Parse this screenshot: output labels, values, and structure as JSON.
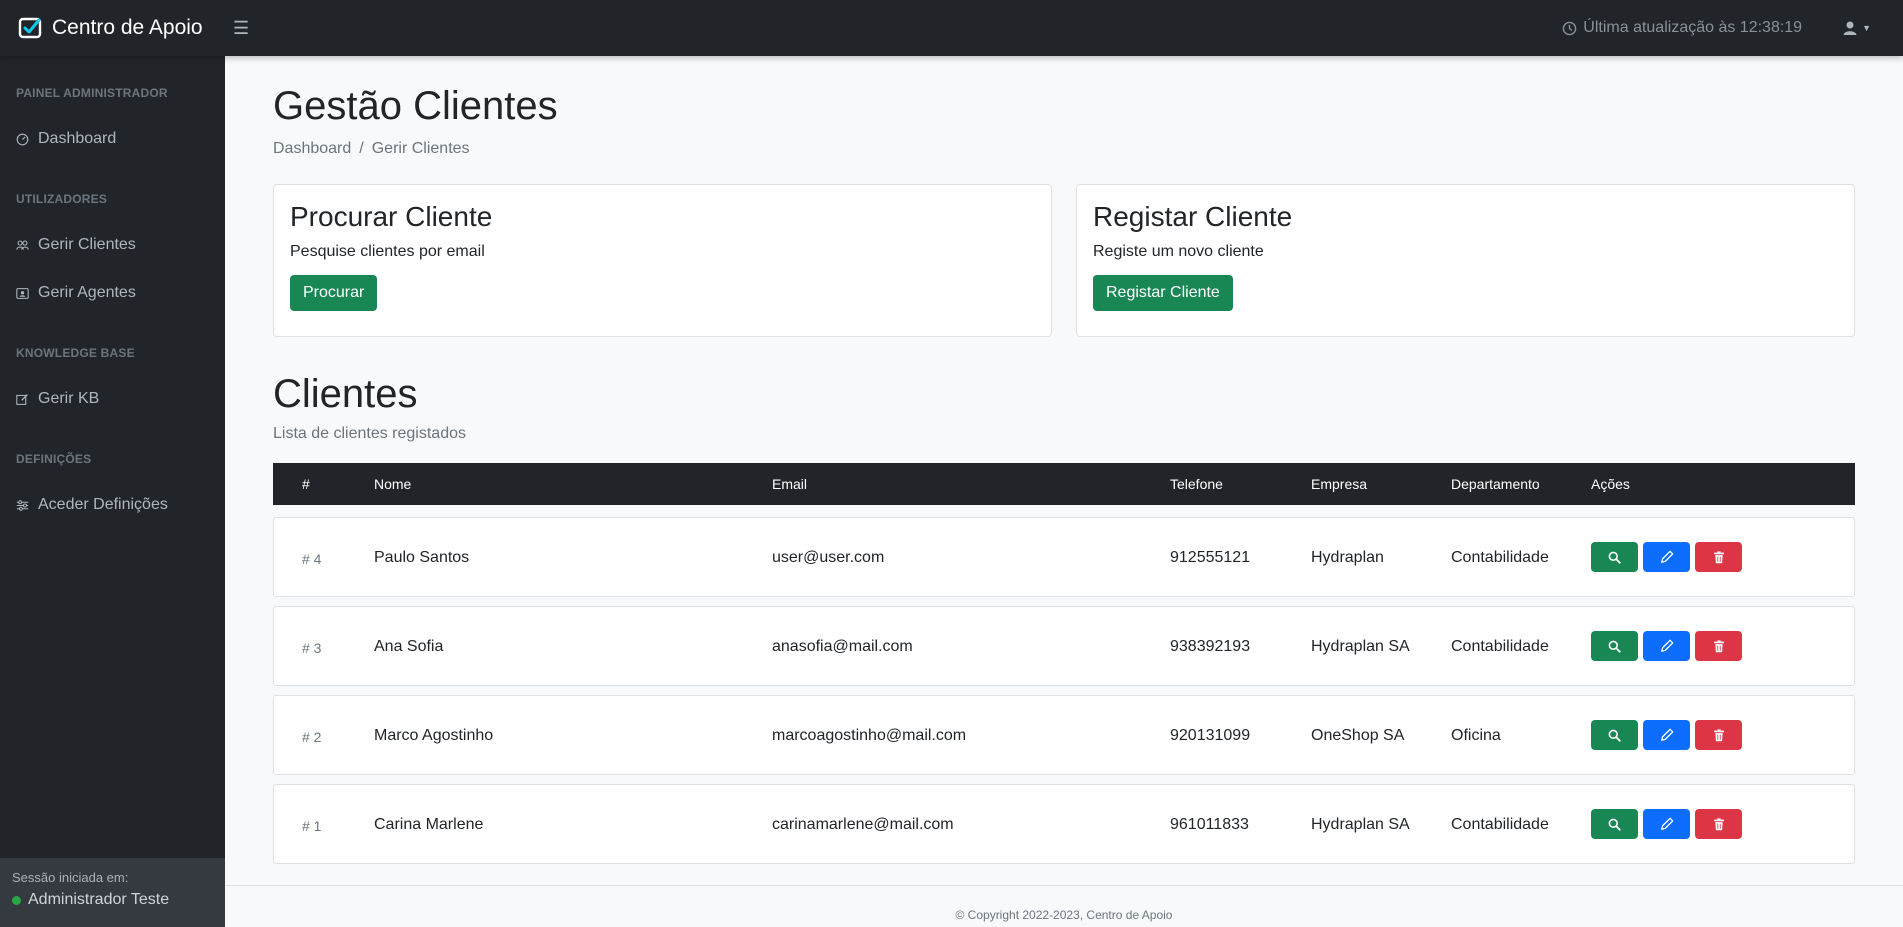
{
  "app": {
    "title": "Centro de Apoio"
  },
  "topbar": {
    "last_update": "Última atualização às 12:38:19"
  },
  "sidebar": {
    "sections": [
      {
        "heading": "PAINEL ADMINISTRADOR",
        "items": [
          {
            "label": "Dashboard",
            "icon": "gauge-icon"
          }
        ]
      },
      {
        "heading": "UTILIZADORES",
        "items": [
          {
            "label": "Gerir Clientes",
            "icon": "users-icon"
          },
          {
            "label": "Gerir Agentes",
            "icon": "id-card-icon"
          }
        ]
      },
      {
        "heading": "KNOWLEDGE BASE",
        "items": [
          {
            "label": "Gerir KB",
            "icon": "edit-icon"
          }
        ]
      },
      {
        "heading": "DEFINIÇÕES",
        "items": [
          {
            "label": "Aceder Definições",
            "icon": "sliders-icon"
          }
        ]
      }
    ],
    "session_label": "Sessão iniciada em:",
    "session_user": "Administrador Teste",
    "session_status_color": "#28a745"
  },
  "page": {
    "title": "Gestão Clientes",
    "breadcrumb": [
      "Dashboard",
      "Gerir Clientes"
    ]
  },
  "cards": {
    "search": {
      "title": "Procurar Cliente",
      "text": "Pesquise clientes por email",
      "button": "Procurar"
    },
    "register": {
      "title": "Registar Cliente",
      "text": "Registe um novo cliente",
      "button": "Registar Cliente"
    }
  },
  "clients": {
    "title": "Clientes",
    "subtitle": "Lista de clientes registados",
    "columns": [
      "#",
      "Nome",
      "Email",
      "Telefone",
      "Empresa",
      "Departamento",
      "Ações"
    ],
    "rows": [
      {
        "id": "# 4",
        "name": "Paulo Santos",
        "email": "user@user.com",
        "phone": "912555121",
        "company": "Hydraplan",
        "department": "Contabilidade"
      },
      {
        "id": "# 3",
        "name": "Ana Sofia",
        "email": "anasofia@mail.com",
        "phone": "938392193",
        "company": "Hydraplan SA",
        "department": "Contabilidade"
      },
      {
        "id": "# 2",
        "name": "Marco Agostinho",
        "email": "marcoagostinho@mail.com",
        "phone": "920131099",
        "company": "OneShop SA",
        "department": "Oficina"
      },
      {
        "id": "# 1",
        "name": "Carina Marlene",
        "email": "carinamarlene@mail.com",
        "phone": "961011833",
        "company": "Hydraplan SA",
        "department": "Contabilidade"
      }
    ]
  },
  "colors": {
    "success": "#198754",
    "primary": "#0d6efd",
    "danger": "#dc3545",
    "dark": "#212529"
  },
  "footer": {
    "text": "© Copyright 2022-2023, Centro de Apoio"
  }
}
